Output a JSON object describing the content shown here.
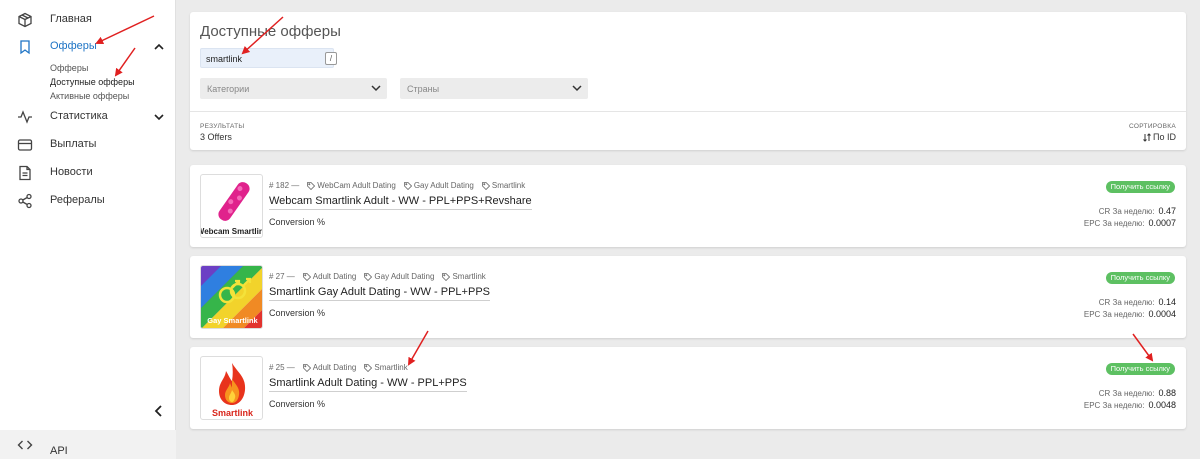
{
  "sidebar": {
    "items": [
      {
        "label": "Главная",
        "icon": "box-icon"
      },
      {
        "label": "Офферы",
        "icon": "bookmark-icon"
      },
      {
        "label": "Статистика",
        "icon": "activity-icon"
      },
      {
        "label": "Выплаты",
        "icon": "credit-card-icon"
      },
      {
        "label": "Новости",
        "icon": "document-icon"
      },
      {
        "label": "Рефералы",
        "icon": "share-icon"
      }
    ],
    "sub_items": [
      "Офферы",
      "Доступные офферы",
      "Активные офферы"
    ],
    "api_label": "API"
  },
  "filters": {
    "title": "Доступные офферы",
    "search_value": "smartlink",
    "search_shortcut": "/",
    "categories_placeholder": "Категории",
    "countries_placeholder": "Страны"
  },
  "results": {
    "label": "РЕЗУЛЬТАТЫ",
    "count": "3 Offers",
    "sort_label": "СОРТИРОВКА",
    "sort_value": "По ID"
  },
  "offers": [
    {
      "id_text": "# 182 —",
      "tags": [
        "WebCam Adult Dating",
        "Gay Adult Dating",
        "Smartlink"
      ],
      "title": "Webcam Smartlink Adult - WW - PPL+PPS+Revshare",
      "conversion": "Conversion %",
      "button": "Получить ссылку",
      "cr_label": "CR За неделю:",
      "cr_value": "0.47",
      "epc_label": "EPC За неделю:",
      "epc_value": "0.0007",
      "image_caption": "Webcam Smartlink"
    },
    {
      "id_text": "# 27 —",
      "tags": [
        "Adult Dating",
        "Gay Adult Dating",
        "Smartlink"
      ],
      "title": "Smartlink Gay Adult Dating - WW - PPL+PPS",
      "conversion": "Conversion %",
      "button": "Получить ссылку",
      "cr_label": "CR За неделю:",
      "cr_value": "0.14",
      "epc_label": "EPC За неделю:",
      "epc_value": "0.0004",
      "image_caption": "Gay Smartlink"
    },
    {
      "id_text": "# 25 —",
      "tags": [
        "Adult Dating",
        "Smartlink"
      ],
      "title": "Smartlink Adult Dating - WW - PPL+PPS",
      "conversion": "Conversion %",
      "button": "Получить ссылку",
      "cr_label": "CR За неделю:",
      "cr_value": "0.88",
      "epc_label": "EPC За неделю:",
      "epc_value": "0.0048",
      "image_caption": "Smartlink"
    }
  ],
  "colors": {
    "accent": "#1e74c5",
    "button_green": "#5dc062",
    "annotation_red": "#e02020"
  }
}
